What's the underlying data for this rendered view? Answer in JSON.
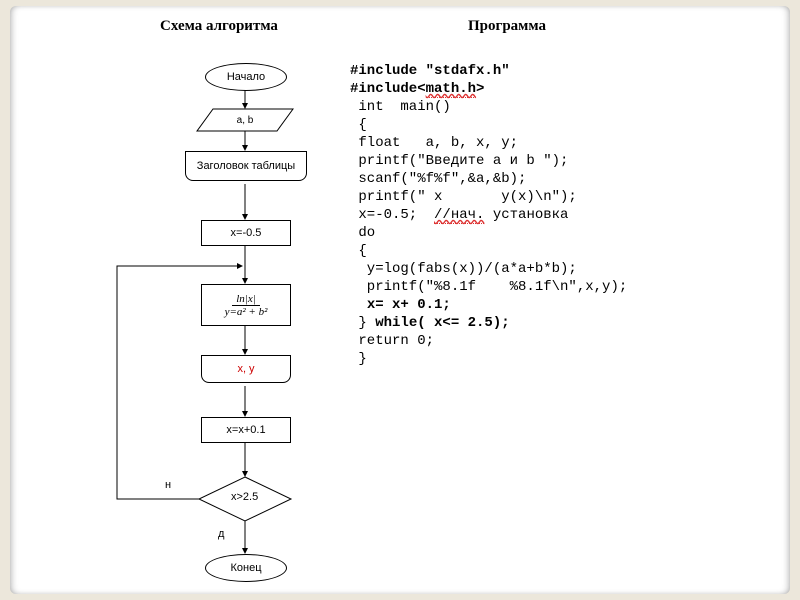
{
  "headings": {
    "left": "Схема алгоритма",
    "right": "Программа"
  },
  "code": {
    "l1a": "#include \"stdafx.h\"",
    "l2a": "#include<",
    "l2b": "math.h",
    "l2c": ">",
    "l3": " int  main()",
    "l4": " {",
    "l5": " float   a, b, x, y;",
    "l6": " printf(\"Введите a и b \");",
    "l7": " scanf(\"%f%f\",&a,&b);",
    "l8": " printf(\" x       y(x)\\n\");",
    "l9a": " x=-0.5;  ",
    "l9b": "//нач.",
    "l9c": " установка",
    "l10": " do",
    "l11": " {",
    "l12": "  y=log(fabs(x))/(a*a+b*b);",
    "l13": "  printf(\"%8.1f    %8.1f\\n\",x,y);",
    "l14a": "  ",
    "l14b": "x= x+ 0.1;",
    "l15a": " } ",
    "l15b": "while( x<= 2.5);",
    "l16": " return 0;",
    "l17": " }"
  },
  "flow": {
    "start": "Начало",
    "input": "a, b",
    "tableHeader": "Заголовок таблицы",
    "init": "x=-0.5",
    "formulaNum": "ln|x|",
    "formulaDen": "y=a² + b²",
    "output2": "x, y",
    "step": "x=x+0.1",
    "cond": "x>2.5",
    "end": "Конец",
    "no": "н",
    "yes": "д"
  }
}
